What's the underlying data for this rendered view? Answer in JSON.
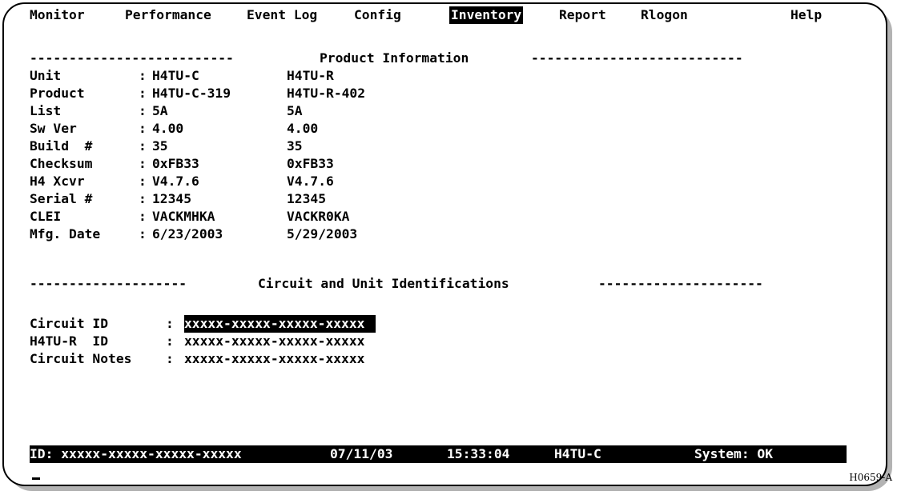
{
  "menu": {
    "items": [
      {
        "label": "Monitor"
      },
      {
        "label": "Performance"
      },
      {
        "label": "Event Log"
      },
      {
        "label": "Config"
      },
      {
        "label": "Inventory",
        "active": true
      },
      {
        "label": "Report"
      },
      {
        "label": "Rlogon"
      }
    ],
    "help": "Help"
  },
  "product_section": {
    "rule_left": "--------------------------",
    "title": "Product Information",
    "rule_right": "---------------------------",
    "rows": [
      {
        "label": "Unit     ",
        "sep": ":",
        "c": "H4TU-C",
        "r": "H4TU-R"
      },
      {
        "label": "Product  ",
        "sep": ":",
        "c": "H4TU-C-319",
        "r": "H4TU-R-402"
      },
      {
        "label": "List     ",
        "sep": ":",
        "c": "5A",
        "r": "5A"
      },
      {
        "label": "Sw Ver   ",
        "sep": ":",
        "c": "4.00",
        "r": "4.00"
      },
      {
        "label": "Build  # ",
        "sep": ":",
        "c": "35",
        "r": "35"
      },
      {
        "label": "Checksum ",
        "sep": ":",
        "c": "0xFB33",
        "r": "0xFB33"
      },
      {
        "label": "H4 Xcvr  ",
        "sep": ":",
        "c": "V4.7.6",
        "r": "V4.7.6"
      },
      {
        "label": "Serial # ",
        "sep": ":",
        "c": "12345",
        "r": "12345"
      },
      {
        "label": "CLEI     ",
        "sep": ":",
        "c": "VACKMHKA",
        "r": "VACKR0KA"
      },
      {
        "label": "Mfg. Date",
        "sep": ":",
        "c": "6/23/2003",
        "r": "5/29/2003"
      }
    ]
  },
  "circuit_section": {
    "rule_left": "--------------------",
    "title": "Circuit and Unit Identifications",
    "rule_right": "---------------------",
    "fields": [
      {
        "label": "Circuit ID   ",
        "sep": ":",
        "value": "xxxxx-xxxxx-xxxxx-xxxxx",
        "highlighted": true
      },
      {
        "label": "H4TU-R  ID   ",
        "sep": ":",
        "value": "xxxxx-xxxxx-xxxxx-xxxxx",
        "highlighted": false
      },
      {
        "label": "Circuit Notes",
        "sep": ":",
        "value": "xxxxx-xxxxx-xxxxx-xxxxx",
        "highlighted": false
      }
    ]
  },
  "status_bar": {
    "id": "ID: xxxxx-xxxxx-xxxxx-xxxxx",
    "date": "07/11/03",
    "time": "15:33:04",
    "unit": "H4TU-C",
    "system": "System: OK"
  },
  "figure_code": "H0659-A"
}
